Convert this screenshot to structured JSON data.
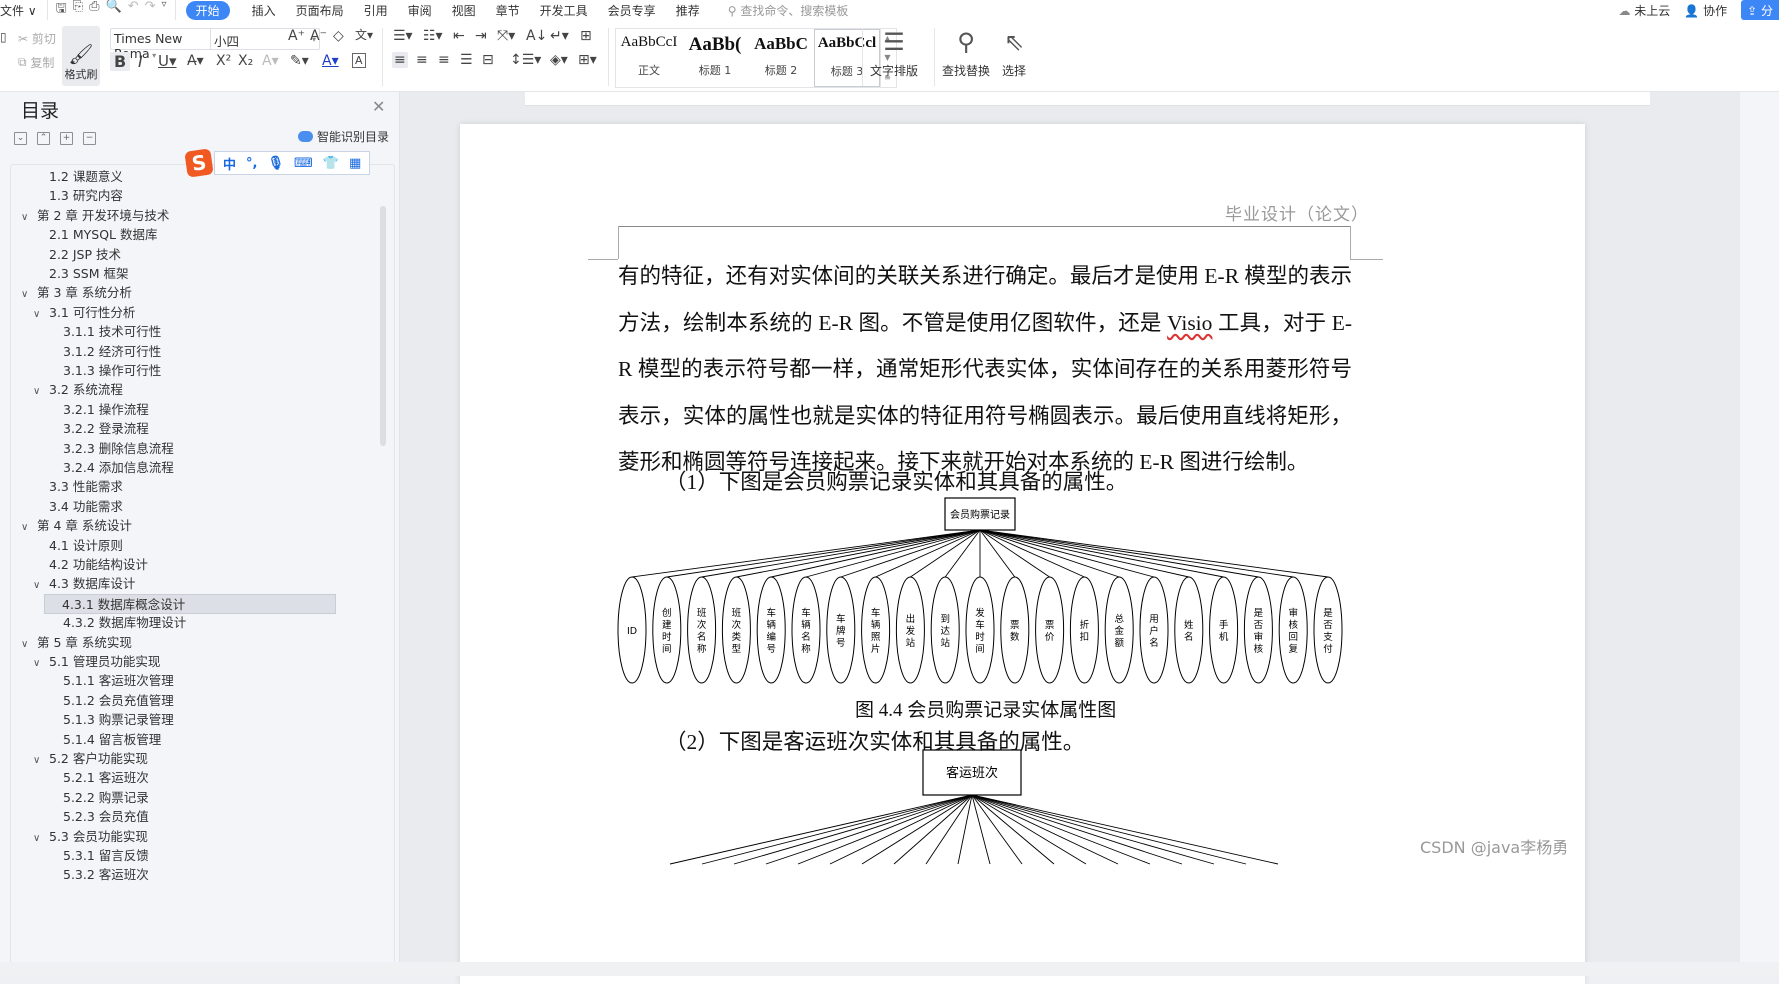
{
  "menubar": {
    "file": "文件",
    "tabs": [
      "开始",
      "插入",
      "页面布局",
      "引用",
      "审阅",
      "视图",
      "章节",
      "开发工具",
      "会员专享",
      "推荐"
    ],
    "active_tab": "开始",
    "search_placeholder": "查找命令、搜索模板",
    "cloud_status": "未上云",
    "collab": "协作",
    "share": "分"
  },
  "ribbon": {
    "cut": "剪切",
    "copy": "复制",
    "format_painter": "格式刷",
    "font_name": "Times New Roma",
    "font_size": "小四",
    "styles": [
      {
        "preview": "AaBbCcI",
        "label": "正文"
      },
      {
        "preview": "AaBb(",
        "label": "标题 1"
      },
      {
        "preview": "AaBbC",
        "label": "标题 2"
      },
      {
        "preview": "AaBbCcl",
        "label": "标题 3"
      }
    ],
    "text_layout": "文字排版",
    "find_replace": "查找替换",
    "select": "选择"
  },
  "sidebar": {
    "title": "目录",
    "smart_toc": "智能识别目录",
    "ime": {
      "mode": "中",
      "punct": "°,"
    },
    "toc": [
      {
        "label": "1.2  课题意义",
        "level": 2,
        "chev": false
      },
      {
        "label": "1.3  研究内容",
        "level": 2,
        "chev": false
      },
      {
        "label": "第 2 章  开发环境与技术",
        "level": 1,
        "chev": true
      },
      {
        "label": "2.1 MYSQL 数据库",
        "level": 2,
        "chev": false
      },
      {
        "label": "2.2 JSP 技术",
        "level": 2,
        "chev": false
      },
      {
        "label": "2.3 SSM 框架",
        "level": 2,
        "chev": false
      },
      {
        "label": "第 3 章  系统分析",
        "level": 1,
        "chev": true
      },
      {
        "label": "3.1  可行性分析",
        "level": 2,
        "chev": true
      },
      {
        "label": "3.1.1  技术可行性",
        "level": 3,
        "chev": false
      },
      {
        "label": "3.1.2  经济可行性",
        "level": 3,
        "chev": false
      },
      {
        "label": "3.1.3  操作可行性",
        "level": 3,
        "chev": false
      },
      {
        "label": "3.2  系统流程",
        "level": 2,
        "chev": true
      },
      {
        "label": "3.2.1  操作流程",
        "level": 3,
        "chev": false
      },
      {
        "label": "3.2.2  登录流程",
        "level": 3,
        "chev": false
      },
      {
        "label": "3.2.3  删除信息流程",
        "level": 3,
        "chev": false
      },
      {
        "label": "3.2.4  添加信息流程",
        "level": 3,
        "chev": false
      },
      {
        "label": "3.3  性能需求",
        "level": 2,
        "chev": false
      },
      {
        "label": "3.4  功能需求",
        "level": 2,
        "chev": false
      },
      {
        "label": "第 4 章  系统设计",
        "level": 1,
        "chev": true
      },
      {
        "label": "4.1  设计原则",
        "level": 2,
        "chev": false
      },
      {
        "label": "4.2  功能结构设计",
        "level": 2,
        "chev": false
      },
      {
        "label": "4.3  数据库设计",
        "level": 2,
        "chev": true
      },
      {
        "label": "4.3.1  数据库概念设计",
        "level": 3,
        "chev": false,
        "selected": true
      },
      {
        "label": "4.3.2  数据库物理设计",
        "level": 3,
        "chev": false
      },
      {
        "label": "第 5 章  系统实现",
        "level": 1,
        "chev": true
      },
      {
        "label": "5.1  管理员功能实现",
        "level": 2,
        "chev": true
      },
      {
        "label": "5.1.1  客运班次管理",
        "level": 3,
        "chev": false
      },
      {
        "label": "5.1.2  会员充值管理",
        "level": 3,
        "chev": false
      },
      {
        "label": "5.1.3  购票记录管理",
        "level": 3,
        "chev": false
      },
      {
        "label": "5.1.4  留言板管理",
        "level": 3,
        "chev": false
      },
      {
        "label": "5.2  客户功能实现",
        "level": 2,
        "chev": true
      },
      {
        "label": "5.2.1  客运班次",
        "level": 3,
        "chev": false
      },
      {
        "label": "5.2.2  购票记录",
        "level": 3,
        "chev": false
      },
      {
        "label": "5.2.3  会员充值",
        "level": 3,
        "chev": false
      },
      {
        "label": "5.3  会员功能实现",
        "level": 2,
        "chev": true
      },
      {
        "label": "5.3.1  留言反馈",
        "level": 3,
        "chev": false
      },
      {
        "label": "5.3.2  客运班次",
        "level": 3,
        "chev": false
      }
    ]
  },
  "document": {
    "header": "毕业设计（论文）",
    "body_part1": "有的特征，还有对实体间的关联关系进行确定。最后才是使用 E-R 模型的表示方法，绘制本系统的 E-R 图。不管是使用亿图软件，还是 ",
    "body_visio": "Visio",
    "body_part2": " 工具，对于 E-R 模型的表示符号都一样，通常矩形代表实体，实体间存在的关系用菱形符号表示，实体的属性也就是实体的特征用符号椭圆表示。最后使用直线将矩形，菱形和椭圆等符号连接起来。接下来就开始对本系统的 E-R 图进行绘制。",
    "para1": "（1）下图是会员购票记录实体和其具备的属性。",
    "er1": {
      "entity": "会员购票记录",
      "attributes": [
        "ID",
        "创建时间",
        "班次名称",
        "班次类型",
        "车辆编号",
        "车辆名称",
        "车牌号",
        "车辆照片",
        "出发站",
        "到达站",
        "发车时间",
        "票数",
        "票价",
        "折扣",
        "总金额",
        "用户名",
        "姓名",
        "手机",
        "是否审核",
        "审核回复",
        "是否支付"
      ]
    },
    "caption1": "图 4.4  会员购票记录实体属性图",
    "para2": "（2）下图是客运班次实体和其具备的属性。",
    "er2": {
      "entity": "客运班次"
    }
  },
  "watermark": "CSDN @java李杨勇"
}
